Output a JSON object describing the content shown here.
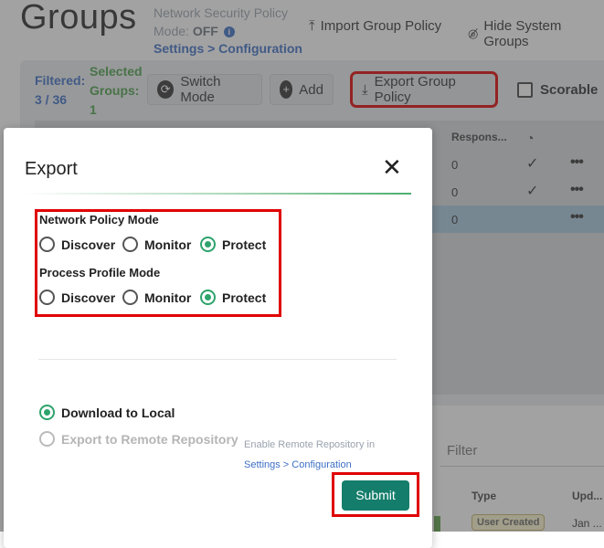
{
  "page": {
    "title": "Groups",
    "policy_label": "Network Security Policy",
    "mode_label": "Mode:",
    "mode_value": "OFF",
    "settings_link": "Settings > Configuration",
    "import_label": "Import Group Policy",
    "hide_system_label": "Hide System Groups"
  },
  "toolbar": {
    "filtered_label": "Filtered:",
    "filtered_value": "3 / 36",
    "selected_label_1": "Selected",
    "selected_label_2": "Groups:",
    "selected_value": "1",
    "switch_mode_label": "Switch Mode",
    "add_label": "Add",
    "export_label": "Export Group Policy",
    "scorable_label": "Scorable"
  },
  "table": {
    "col_response": "Respons...",
    "rows": [
      {
        "response": "0",
        "check": "✓"
      },
      {
        "response": "0",
        "check": "✓"
      },
      {
        "response": "0",
        "check": ""
      }
    ]
  },
  "lower": {
    "filter_placeholder": "Filter",
    "col_type": "Type",
    "col_updated": "Upd...",
    "type_badge": "User Created",
    "updated_value": "Jan ..."
  },
  "modal": {
    "title": "Export",
    "network_mode_label": "Network Policy Mode",
    "process_mode_label": "Process Profile Mode",
    "options": [
      "Discover",
      "Monitor",
      "Protect"
    ],
    "network_selected": "Protect",
    "process_selected": "Protect",
    "download_local_label": "Download to Local",
    "export_remote_label": "Export to Remote Repository",
    "remote_hint": "Enable Remote Repository in",
    "remote_hint_link": "Settings > Configuration",
    "submit_label": "Submit"
  },
  "colors": {
    "accent_green": "#2ea36c",
    "submit_bg": "#147d6b",
    "highlight_red": "#e00000",
    "link_blue": "#3d6fc6"
  }
}
